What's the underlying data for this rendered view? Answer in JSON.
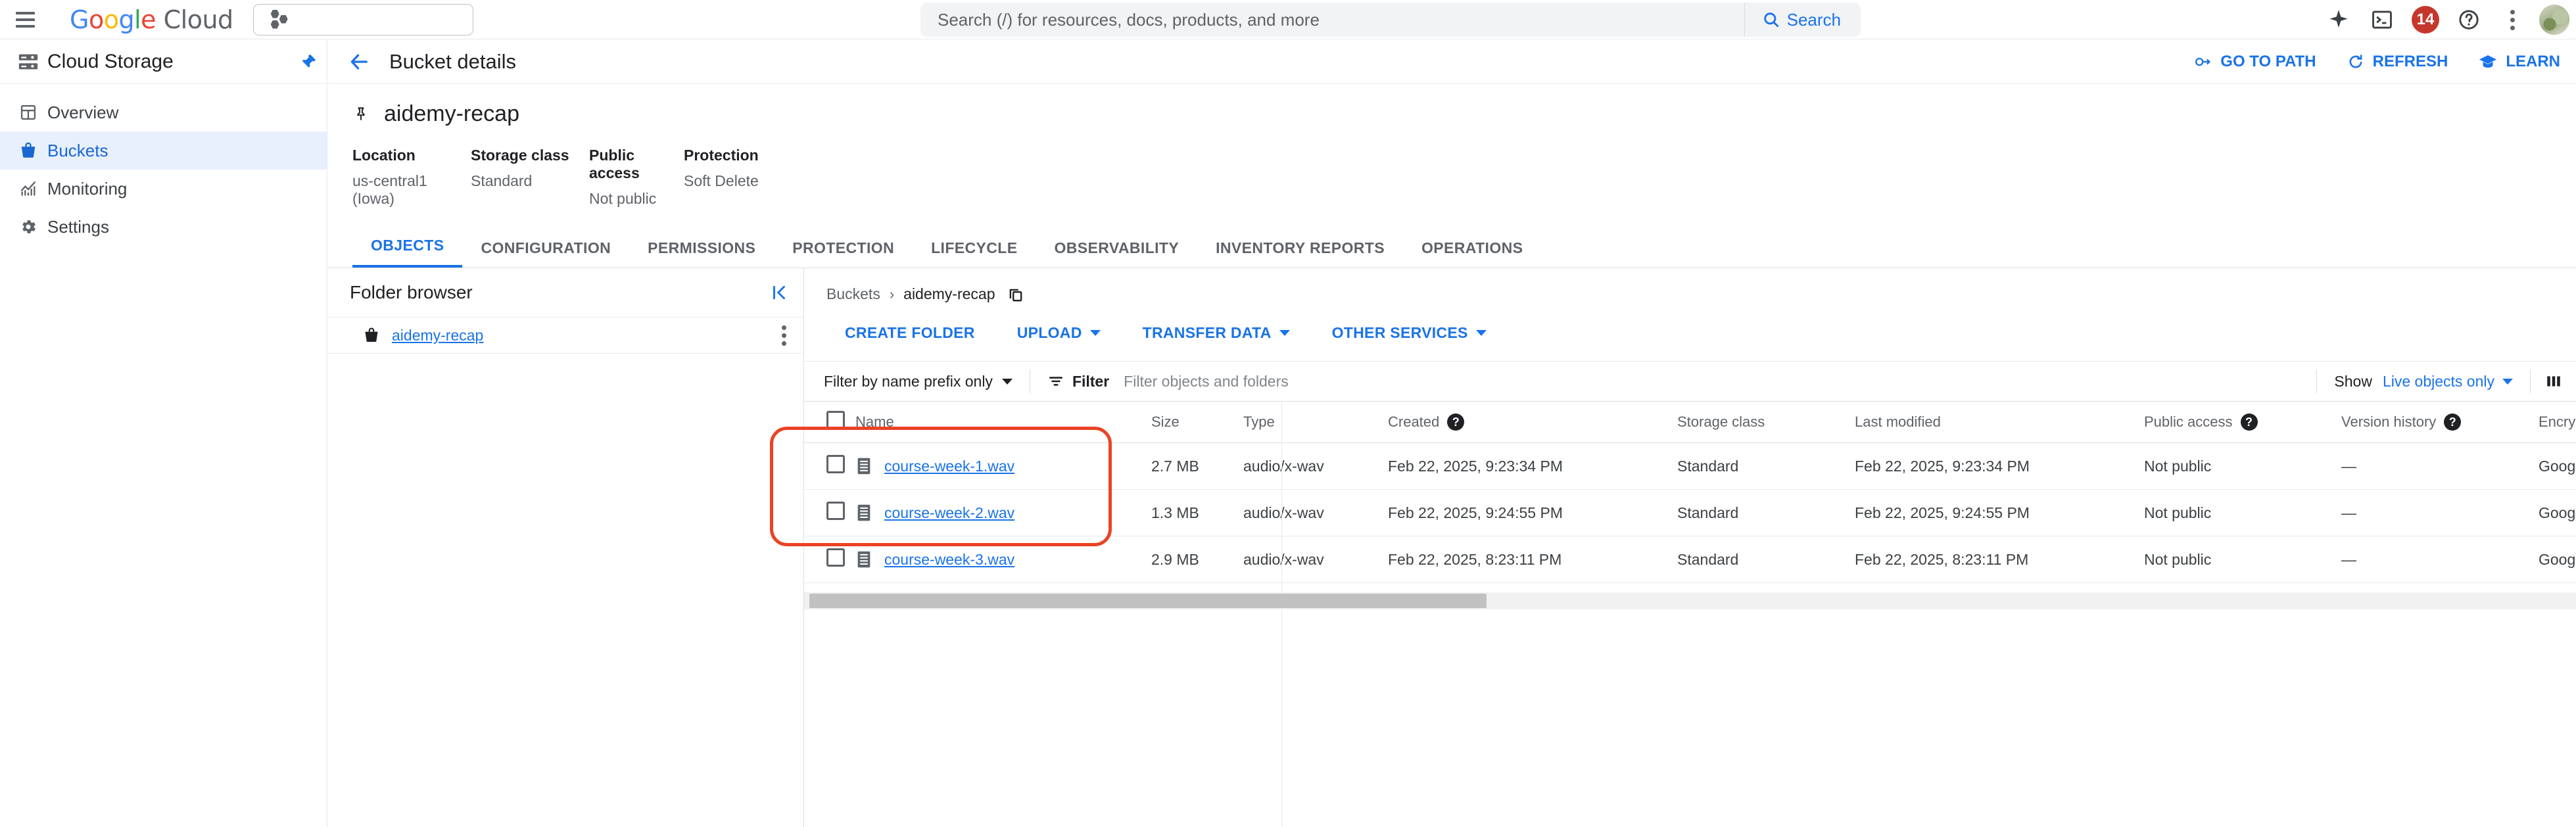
{
  "topbar": {
    "menu_icon": "hamburger-menu-icon",
    "logo_google": "Google",
    "logo_cloud": "Cloud",
    "project_selector_placeholder": "",
    "search": {
      "placeholder": "Search (/) for resources, docs, products, and more",
      "value": "",
      "button_label": "Search"
    },
    "icons": {
      "gemini": "gemini-sparkle-icon",
      "cloud_shell": "cloud-shell-terminal-icon",
      "notifications_count": "14",
      "help": "help-icon",
      "more": "more-options-icon",
      "avatar": "user-avatar"
    }
  },
  "sidebar": {
    "product_title": "Cloud Storage",
    "pin_label": "pin-icon",
    "items": [
      {
        "label": "Overview",
        "icon": "dashboard-icon",
        "active": false
      },
      {
        "label": "Buckets",
        "icon": "bucket-icon",
        "active": true
      },
      {
        "label": "Monitoring",
        "icon": "monitoring-chart-icon",
        "active": false
      },
      {
        "label": "Settings",
        "icon": "gear-icon",
        "active": false
      }
    ]
  },
  "page": {
    "back_label": "back-arrow-icon",
    "title": "Bucket details",
    "actions": [
      {
        "label": "GO TO PATH",
        "icon": "link-path-icon"
      },
      {
        "label": "REFRESH",
        "icon": "refresh-icon"
      },
      {
        "label": "LEARN",
        "icon": "learn-graduation-icon"
      }
    ]
  },
  "bucket": {
    "name": "aidemy-recap",
    "pin_icon": "pin-outline-icon",
    "meta": [
      {
        "label": "Location",
        "value": "us-central1 (Iowa)"
      },
      {
        "label": "Storage class",
        "value": "Standard"
      },
      {
        "label": "Public access",
        "value": "Not public"
      },
      {
        "label": "Protection",
        "value": "Soft Delete"
      }
    ]
  },
  "tabs": [
    {
      "label": "OBJECTS",
      "active": true
    },
    {
      "label": "CONFIGURATION",
      "active": false
    },
    {
      "label": "PERMISSIONS",
      "active": false
    },
    {
      "label": "PROTECTION",
      "active": false
    },
    {
      "label": "LIFECYCLE",
      "active": false
    },
    {
      "label": "OBSERVABILITY",
      "active": false
    },
    {
      "label": "INVENTORY REPORTS",
      "active": false
    },
    {
      "label": "OPERATIONS",
      "active": false
    }
  ],
  "folder_browser": {
    "title": "Folder browser",
    "collapse_icon": "collapse-panel-icon",
    "root": {
      "label": "aidemy-recap",
      "icon": "bucket-icon",
      "menu_icon": "kebab-menu-icon"
    }
  },
  "objects": {
    "breadcrumb": {
      "root": "Buckets",
      "separator": "›",
      "current": "aidemy-recap",
      "copy_icon": "copy-icon"
    },
    "actions": [
      {
        "label": "CREATE FOLDER",
        "has_caret": false
      },
      {
        "label": "UPLOAD",
        "has_caret": true
      },
      {
        "label": "TRANSFER DATA",
        "has_caret": true
      },
      {
        "label": "OTHER SERVICES",
        "has_caret": true
      }
    ],
    "filter_bar": {
      "prefix_mode": "Filter by name prefix only",
      "filter_icon": "filter-icon",
      "filter_label": "Filter",
      "filter_placeholder": "Filter objects and folders",
      "filter_value": "",
      "show_label": "Show",
      "show_value": "Live objects only",
      "columns_icon": "column-settings-icon"
    },
    "columns": [
      {
        "key": "checkbox",
        "label": ""
      },
      {
        "key": "name",
        "label": "Name"
      },
      {
        "key": "size",
        "label": "Size"
      },
      {
        "key": "type",
        "label": "Type"
      },
      {
        "key": "created",
        "label": "Created",
        "help": true
      },
      {
        "key": "storage_class",
        "label": "Storage class"
      },
      {
        "key": "last_modified",
        "label": "Last modified"
      },
      {
        "key": "public_access",
        "label": "Public access",
        "help": true
      },
      {
        "key": "version_history",
        "label": "Version history",
        "help": true
      },
      {
        "key": "encryption",
        "label": "Encryption",
        "help": true
      }
    ],
    "rows": [
      {
        "name": "course-week-1.wav",
        "size": "2.7 MB",
        "type": "audio/x-wav",
        "created": "Feb 22, 2025, 9:23:34 PM",
        "storage_class": "Standard",
        "last_modified": "Feb 22, 2025, 9:23:34 PM",
        "public_access": "Not public",
        "version_history": "—",
        "encryption": "Google-mana",
        "file_icon": "audio-file-icon",
        "download_icon": "download-icon"
      },
      {
        "name": "course-week-2.wav",
        "size": "1.3 MB",
        "type": "audio/x-wav",
        "created": "Feb 22, 2025, 9:24:55 PM",
        "storage_class": "Standard",
        "last_modified": "Feb 22, 2025, 9:24:55 PM",
        "public_access": "Not public",
        "version_history": "—",
        "encryption": "Google-mana",
        "file_icon": "audio-file-icon",
        "download_icon": "download-icon"
      },
      {
        "name": "course-week-3.wav",
        "size": "2.9 MB",
        "type": "audio/x-wav",
        "created": "Feb 22, 2025, 8:23:11 PM",
        "storage_class": "Standard",
        "last_modified": "Feb 22, 2025, 8:23:11 PM",
        "public_access": "Not public",
        "version_history": "—",
        "encryption": "Google-mana",
        "file_icon": "audio-file-icon",
        "download_icon": "download-icon"
      }
    ]
  },
  "annotation": {
    "color": "#ea4325",
    "target": "object-name-column"
  }
}
